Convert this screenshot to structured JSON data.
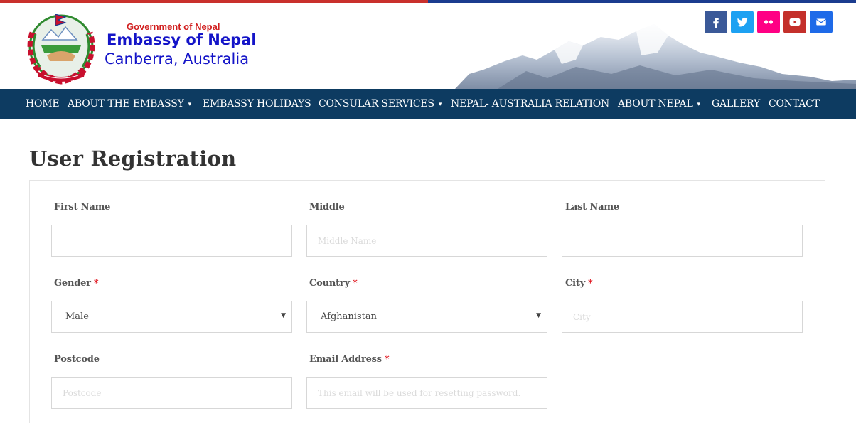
{
  "header": {
    "gov": "Government of Nepal",
    "embassy": "Embassy of Nepal",
    "location": "Canberra, Australia"
  },
  "social": [
    {
      "name": "facebook-icon",
      "color": "#3b5998"
    },
    {
      "name": "twitter-icon",
      "color": "#1da1f2"
    },
    {
      "name": "flickr-icon",
      "color": "#ff0084"
    },
    {
      "name": "youtube-icon",
      "color": "#c4302b"
    },
    {
      "name": "email-icon",
      "color": "#1e6ae8"
    }
  ],
  "nav": {
    "home": "HOME",
    "about_embassy": "ABOUT THE EMBASSY",
    "holidays": "EMBASSY HOLIDAYS",
    "consular": "CONSULAR SERVICES",
    "relation": "NEPAL- AUSTRALIA RELATION",
    "about_nepal": "ABOUT NEPAL",
    "gallery": "GALLERY",
    "contact": "CONTACT",
    "caret": "▾"
  },
  "page": {
    "title": "User Registration"
  },
  "form": {
    "required_mark": "*",
    "first_name": {
      "label": "First Name",
      "value": "",
      "placeholder": ""
    },
    "middle": {
      "label": "Middle",
      "value": "",
      "placeholder": "Middle Name"
    },
    "last_name": {
      "label": "Last Name",
      "value": "",
      "placeholder": ""
    },
    "gender": {
      "label": "Gender",
      "selected": "Male"
    },
    "country": {
      "label": "Country",
      "selected": "Afghanistan"
    },
    "city": {
      "label": "City",
      "value": "",
      "placeholder": "City"
    },
    "postcode": {
      "label": "Postcode",
      "value": "",
      "placeholder": "Postcode"
    },
    "email": {
      "label": "Email Address",
      "value": "",
      "placeholder": "This email will be used for resetting password."
    }
  },
  "colors": {
    "nav_bg": "#0d3b61",
    "title_blue": "#1414c8",
    "gov_red": "#d11f1f",
    "required_red": "#e0161f"
  }
}
